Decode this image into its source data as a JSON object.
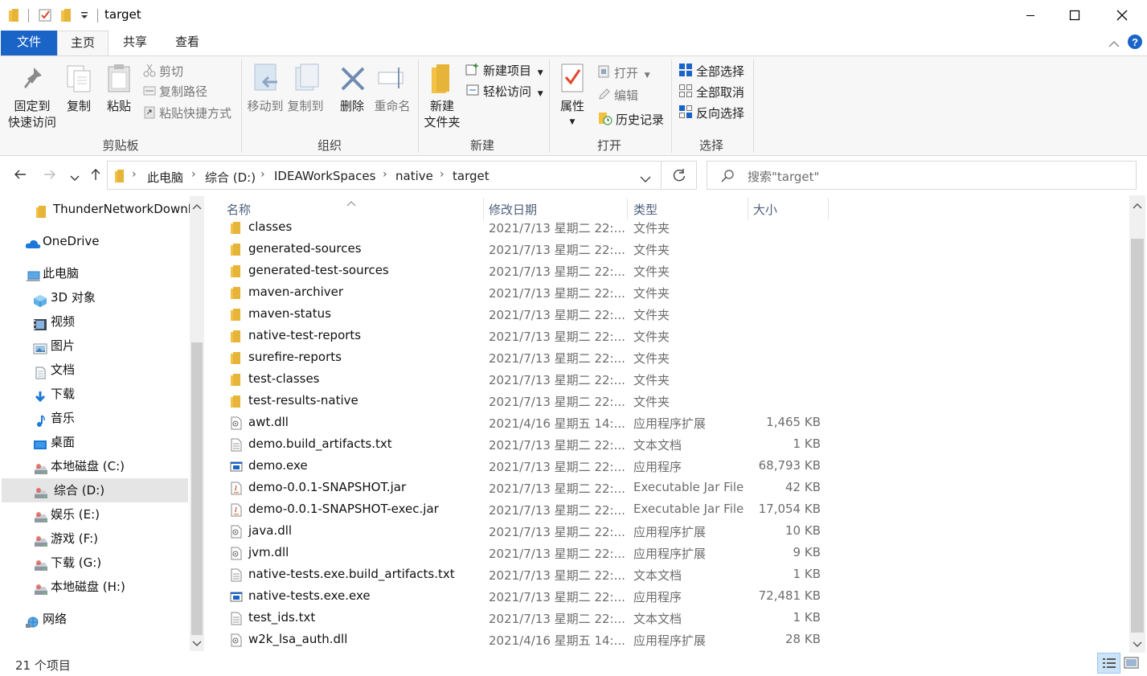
{
  "window": {
    "title": "target",
    "quick_access_icons": [
      "folder-icon",
      "checkbox-icon",
      "folder-icon",
      "dropdown-arrow-icon"
    ],
    "controls": [
      "minimize-icon",
      "maximize-icon",
      "close-icon"
    ]
  },
  "ribbon_tabs": {
    "file": "文件",
    "home": "主页",
    "share": "共享",
    "view": "查看"
  },
  "ribbon": {
    "clipboard": {
      "label": "剪贴板",
      "pin": "固定到\n快速访问",
      "pin_line1": "固定到",
      "pin_line2": "快速访问",
      "copy": "复制",
      "paste": "粘贴",
      "cut": "剪切",
      "copy_path": "复制路径",
      "paste_shortcut": "粘贴快捷方式"
    },
    "organize": {
      "label": "组织",
      "move_to": "移动到",
      "copy_to": "复制到",
      "delete": "删除",
      "rename": "重命名"
    },
    "new": {
      "label": "新建",
      "new_folder_line1": "新建",
      "new_folder_line2": "文件夹",
      "new_item": "新建项目",
      "easy_access": "轻松访问"
    },
    "open": {
      "label": "打开",
      "properties": "属性",
      "open": "打开",
      "edit": "编辑",
      "history": "历史记录"
    },
    "select": {
      "label": "选择",
      "select_all": "全部选择",
      "select_none": "全部取消",
      "invert": "反向选择"
    }
  },
  "address": {
    "crumbs": [
      "此电脑",
      "综合 (D:)",
      "IDEAWorkSpaces",
      "native",
      "target"
    ],
    "search_placeholder": "搜索\"target\""
  },
  "nav": {
    "items": [
      {
        "label": "ThunderNetworkDownl",
        "icon": "folder-icon"
      },
      {
        "label": "OneDrive",
        "icon": "cloud-icon"
      },
      {
        "label": "此电脑",
        "icon": "computer-icon"
      },
      {
        "label": "3D 对象",
        "icon": "cube-icon"
      },
      {
        "label": "视频",
        "icon": "film-icon"
      },
      {
        "label": "图片",
        "icon": "picture-icon"
      },
      {
        "label": "文档",
        "icon": "document-icon"
      },
      {
        "label": "下载",
        "icon": "download-icon"
      },
      {
        "label": "音乐",
        "icon": "music-icon"
      },
      {
        "label": "桌面",
        "icon": "desktop-icon"
      },
      {
        "label": "本地磁盘 (C:)",
        "icon": "drive-icon"
      },
      {
        "label": "综合 (D:)",
        "icon": "drive-icon"
      },
      {
        "label": "娱乐 (E:)",
        "icon": "drive-icon"
      },
      {
        "label": "游戏 (F:)",
        "icon": "drive-icon"
      },
      {
        "label": "下载 (G:)",
        "icon": "drive-icon"
      },
      {
        "label": "本地磁盘 (H:)",
        "icon": "drive-icon"
      },
      {
        "label": "网络",
        "icon": "network-icon"
      }
    ]
  },
  "columns": {
    "name": "名称",
    "date": "修改日期",
    "type": "类型",
    "size": "大小"
  },
  "files": [
    {
      "name": "classes",
      "date": "2021/7/13 星期二 22:...",
      "type": "文件夹",
      "size": "",
      "icon": "folder-icon"
    },
    {
      "name": "generated-sources",
      "date": "2021/7/13 星期二 22:...",
      "type": "文件夹",
      "size": "",
      "icon": "folder-icon"
    },
    {
      "name": "generated-test-sources",
      "date": "2021/7/13 星期二 22:...",
      "type": "文件夹",
      "size": "",
      "icon": "folder-icon"
    },
    {
      "name": "maven-archiver",
      "date": "2021/7/13 星期二 22:...",
      "type": "文件夹",
      "size": "",
      "icon": "folder-icon"
    },
    {
      "name": "maven-status",
      "date": "2021/7/13 星期二 22:...",
      "type": "文件夹",
      "size": "",
      "icon": "folder-icon"
    },
    {
      "name": "native-test-reports",
      "date": "2021/7/13 星期二 22:...",
      "type": "文件夹",
      "size": "",
      "icon": "folder-icon"
    },
    {
      "name": "surefire-reports",
      "date": "2021/7/13 星期二 22:...",
      "type": "文件夹",
      "size": "",
      "icon": "folder-icon"
    },
    {
      "name": "test-classes",
      "date": "2021/7/13 星期二 22:...",
      "type": "文件夹",
      "size": "",
      "icon": "folder-icon"
    },
    {
      "name": "test-results-native",
      "date": "2021/7/13 星期二 22:...",
      "type": "文件夹",
      "size": "",
      "icon": "folder-icon"
    },
    {
      "name": "awt.dll",
      "date": "2021/4/16 星期五 14:...",
      "type": "应用程序扩展",
      "size": "1,465 KB",
      "icon": "dll-icon"
    },
    {
      "name": "demo.build_artifacts.txt",
      "date": "2021/7/13 星期二 22:...",
      "type": "文本文档",
      "size": "1 KB",
      "icon": "text-file-icon"
    },
    {
      "name": "demo.exe",
      "date": "2021/7/13 星期二 22:...",
      "type": "应用程序",
      "size": "68,793 KB",
      "icon": "exe-icon"
    },
    {
      "name": "demo-0.0.1-SNAPSHOT.jar",
      "date": "2021/7/13 星期二 22:...",
      "type": "Executable Jar File",
      "size": "42 KB",
      "icon": "jar-icon"
    },
    {
      "name": "demo-0.0.1-SNAPSHOT-exec.jar",
      "date": "2021/7/13 星期二 22:...",
      "type": "Executable Jar File",
      "size": "17,054 KB",
      "icon": "jar-icon"
    },
    {
      "name": "java.dll",
      "date": "2021/7/13 星期二 22:...",
      "type": "应用程序扩展",
      "size": "10 KB",
      "icon": "dll-icon"
    },
    {
      "name": "jvm.dll",
      "date": "2021/7/13 星期二 22:...",
      "type": "应用程序扩展",
      "size": "9 KB",
      "icon": "dll-icon"
    },
    {
      "name": "native-tests.exe.build_artifacts.txt",
      "date": "2021/7/13 星期二 22:...",
      "type": "文本文档",
      "size": "1 KB",
      "icon": "text-file-icon"
    },
    {
      "name": "native-tests.exe.exe",
      "date": "2021/7/13 星期二 22:...",
      "type": "应用程序",
      "size": "72,481 KB",
      "icon": "exe-icon"
    },
    {
      "name": "test_ids.txt",
      "date": "2021/7/13 星期二 22:...",
      "type": "文本文档",
      "size": "1 KB",
      "icon": "text-file-icon"
    },
    {
      "name": "w2k_lsa_auth.dll",
      "date": "2021/4/16 星期五 14:...",
      "type": "应用程序扩展",
      "size": "28 KB",
      "icon": "dll-icon"
    }
  ],
  "status": {
    "count": "21 个项目"
  },
  "colors": {
    "file_tab": "#1a64c8",
    "folder": "#f3c244",
    "selection": "#e5e5e5"
  }
}
